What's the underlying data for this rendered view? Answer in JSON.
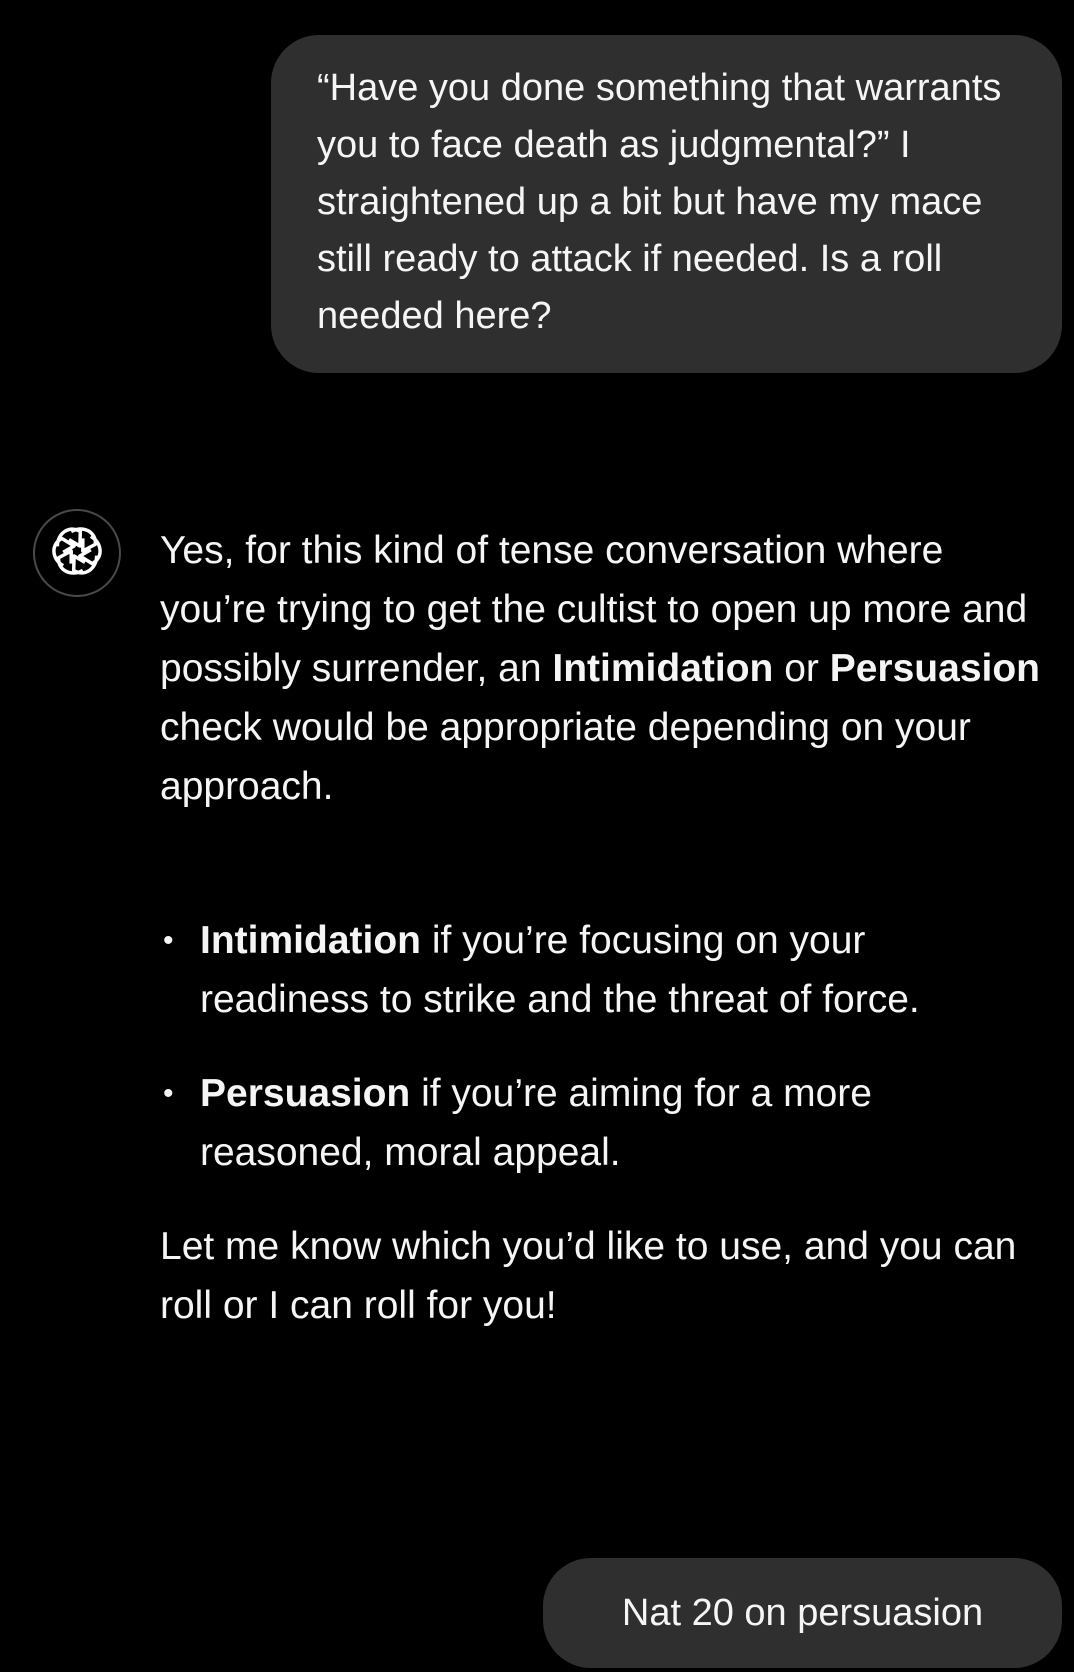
{
  "messages": {
    "user_1": {
      "text": "“Have you done something that warrants you to face death as judgmental?” I straightened up a bit but have my mace still ready to attack if needed. Is a roll needed here?"
    },
    "assistant": {
      "avatar_icon": "openai-logo-icon",
      "intro_1": "Yes, for this kind of tense conversation where you’re trying to get the cultist to open up more and possibly surrender, an ",
      "intro_bold_1": "Intimidation",
      "intro_2": " or ",
      "intro_bold_2": "Persuasion",
      "intro_3": " check would be appropriate depending on your approach.",
      "bullets": [
        {
          "bullet": "•",
          "bold": "Intimidation",
          "text": " if you’re focusing on your readiness to strike and the threat of force."
        },
        {
          "bullet": "•",
          "bold": "Persuasion",
          "text": " if you’re aiming for a more reasoned, moral appeal."
        }
      ],
      "closing": "Let me know which you’d like to use, and you can roll or I can roll for you!"
    },
    "user_2": {
      "text": "Nat 20 on persuasion"
    }
  },
  "colors": {
    "background": "#000000",
    "user_bubble": "#2f2f2f",
    "text": "#f5f5f5",
    "avatar_border": "#4a4a4a"
  }
}
